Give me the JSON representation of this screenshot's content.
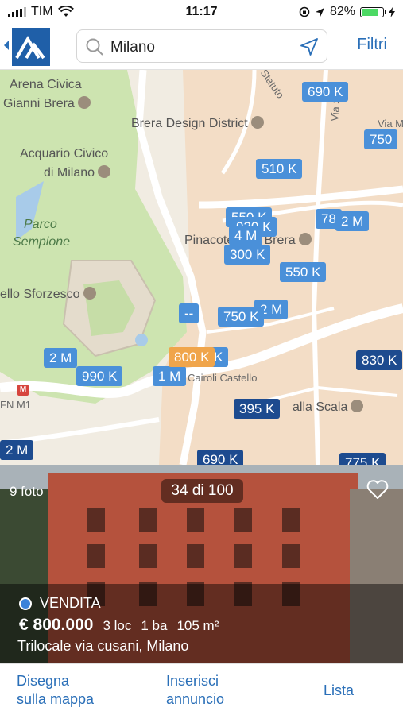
{
  "status": {
    "carrier": "TIM",
    "time": "11:17",
    "battery": "82%",
    "battery_level": 0.82
  },
  "header": {
    "search_value": "Milano",
    "filter_label": "Filtri"
  },
  "map": {
    "labels": {
      "arena": "Arena Civica",
      "arena2": "Gianni Brera",
      "brera_district": "Brera Design District",
      "acquario": "Acquario Civico",
      "acquario2": "di Milano",
      "parco": "Parco",
      "parco2": "Sempione",
      "pinacoteca": "Pinacoteca di Brera",
      "sforzesco": "ello Sforzesco",
      "cairoli": "Cairoli Castello",
      "scala": "alla Scala",
      "fnm": "FN M1",
      "statuto": "Statuto",
      "via_s": "Via S.",
      "via_m": "Via M"
    },
    "pins": {
      "p690_top": "690 K",
      "p750_right": "750",
      "p510": "510 K",
      "p550_a": "550 K",
      "p930": "930 K",
      "p4m": "4 M",
      "p300": "300 K",
      "p78": "78",
      "p2m_right": "2 M",
      "p550_b": "550 K",
      "pdash": "--",
      "p750_mid": "750 K",
      "p2m_mid": "2 M",
      "p2m_left": "2 M",
      "p990": "990 K",
      "p1m": "1 M",
      "p800": "800 K",
      "pk": "K",
      "p830": "830 K",
      "p395": "395 K",
      "p2m_bottom": "2 M",
      "p690_bottom": "690 K",
      "p775": "775 K"
    }
  },
  "listing": {
    "photo_count": "9 foto",
    "counter": "34 di 100",
    "type": "VENDITA",
    "price": "€ 800.000",
    "rooms": "3 loc",
    "baths": "1 ba",
    "area": "105 m²",
    "title": "Trilocale via cusani, Milano"
  },
  "bottom_nav": {
    "draw_line1": "Disegna",
    "draw_line2": "sulla mappa",
    "insert_line1": "Inserisci",
    "insert_line2": "annuncio",
    "list": "Lista"
  }
}
